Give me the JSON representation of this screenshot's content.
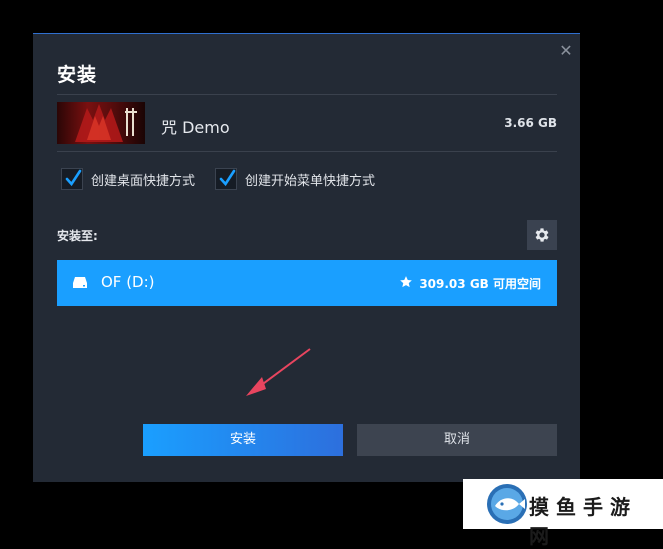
{
  "dialog": {
    "title": "安装",
    "close_icon": "close-icon"
  },
  "game": {
    "name": "咒 Demo",
    "size": "3.66 GB"
  },
  "options": [
    {
      "label": "创建桌面快捷方式",
      "checked": true
    },
    {
      "label": "创建开始菜单快捷方式",
      "checked": true
    }
  ],
  "install_to": {
    "label": "安装至:",
    "settings_icon": "gear-icon"
  },
  "drive": {
    "name": "OF (D:)",
    "free_space": "309.03 GB 可用空间",
    "is_default": true
  },
  "buttons": {
    "install": "安装",
    "cancel": "取消"
  },
  "watermark": {
    "text": "摸鱼手游网"
  },
  "colors": {
    "accent": "#1a9fff",
    "dialog_bg": "#232a35",
    "annotation_arrow": "#e8455f"
  }
}
